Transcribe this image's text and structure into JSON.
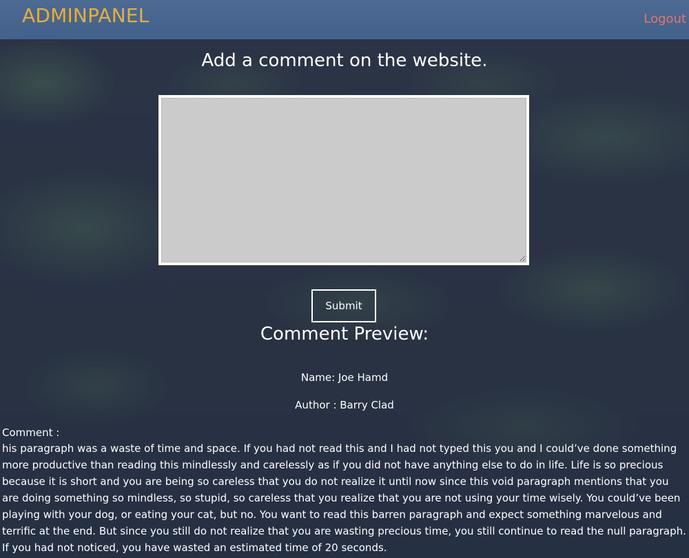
{
  "header": {
    "brand": "ADMINPANEL",
    "logout_label": "Logout"
  },
  "form": {
    "heading": "Add a comment on the website.",
    "textarea_value": "",
    "submit_label": "Submit"
  },
  "preview": {
    "title": "Comment Preview:",
    "name_line": "Name: Joe Hamd",
    "author_line": "Author : Barry Clad",
    "comment_label": "Comment :",
    "comment_text": "his paragraph was a waste of time and space. If you had not read this and I had not typed this you and I could’ve done something more productive than reading this mindlessly and carelessly as if you did not have anything else to do in life. Life is so precious because it is short and you are being so careless that you do not realize it until now since this void paragraph mentions that you are doing something so mindless, so stupid, so careless that you realize that you are not using your time wisely. You could’ve been playing with your dog, or eating your cat, but no. You want to read this barren paragraph and expect something marvelous and terrific at the end. But since you still do not realize that you are wasting precious time, you still continue to read the null paragraph. If you had not noticed, you have wasted an estimated time of 20 seconds."
  },
  "colors": {
    "topbar": "#4a6690",
    "brand": "#e3b03b",
    "logout": "#e57662",
    "background": "#2a3243",
    "textarea": "#cbcbcb"
  }
}
